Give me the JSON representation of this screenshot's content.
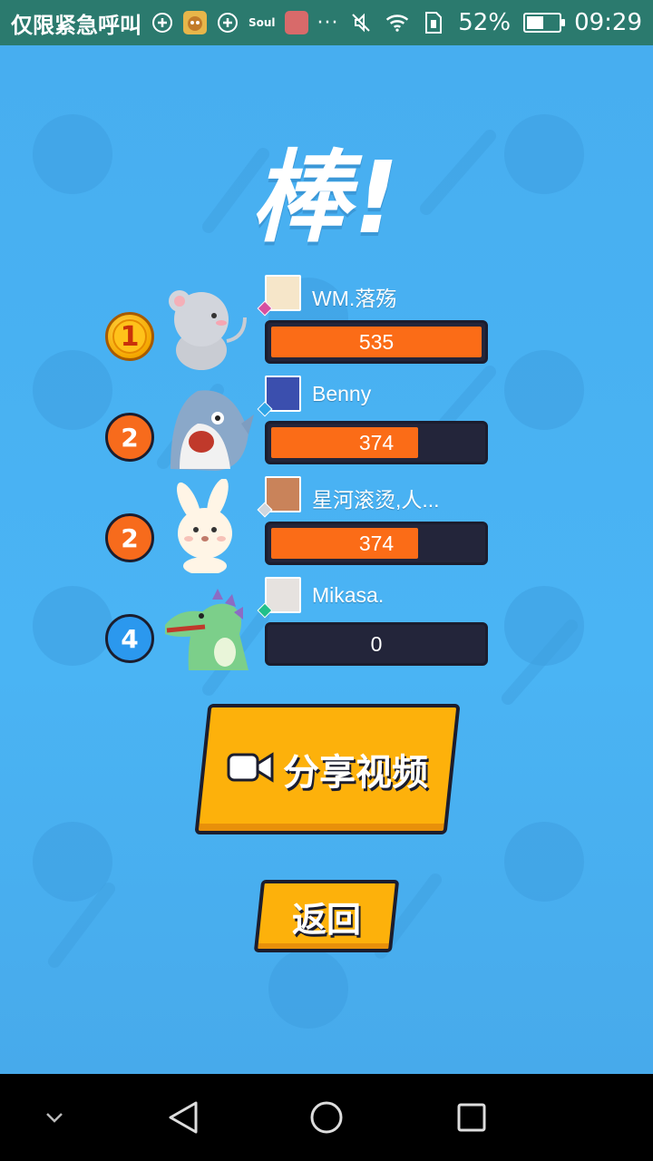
{
  "status_bar": {
    "carrier": "仅限紧急呼叫",
    "soul_label": "Soul",
    "more": "···",
    "battery_text": "52%",
    "battery_level": 0.52,
    "time": "09:29"
  },
  "game": {
    "title": "棒!",
    "leaderboard": [
      {
        "rank": "1",
        "name": "WM.落殇",
        "score": "535",
        "fill": 1.0
      },
      {
        "rank": "2",
        "name": "Benny",
        "score": "374",
        "fill": 0.7
      },
      {
        "rank": "2",
        "name": "星河滚烫,人...",
        "score": "374",
        "fill": 0.7
      },
      {
        "rank": "4",
        "name": "Mikasa.",
        "score": "0",
        "fill": 0
      }
    ],
    "share_label": "分享视频",
    "back_label": "返回"
  },
  "colors": {
    "bg": "#4ab4f4",
    "bar_fill": "#fb6c17",
    "button": "#fdb10b",
    "outline": "#1b1d2e"
  }
}
